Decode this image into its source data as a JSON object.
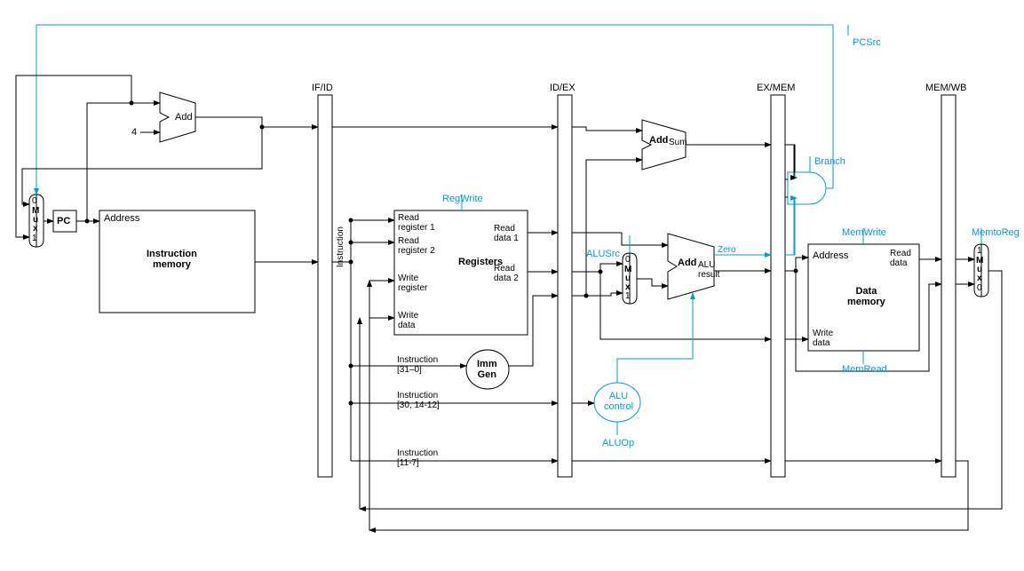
{
  "pcsrc": "PCSrc",
  "add1": "Add",
  "const4": "4",
  "ifid": "IF/ID",
  "idex": "ID/EX",
  "exmem": "EX/MEM",
  "memwb": "MEM/WB",
  "addsum_add": "Add",
  "addsum_sum": "Sum",
  "branch": "Branch",
  "pc": "PC",
  "address1": "Address",
  "imem": "Instruction\nmemory",
  "instruction_v": "Instruction",
  "regwrite": "RegWrite",
  "rr1": "Read\nregister 1",
  "rr2": "Read\nregister 2",
  "wr": "Write\nregister",
  "wd": "Write\ndata",
  "rd1": "Read\ndata 1",
  "rd2": "Read\ndata 2",
  "registers": "Registers",
  "alusrc": "ALUSrc",
  "zero": "Zero",
  "alu_add": "Add",
  "alu_res": "ALU\nresult",
  "memwrite": "MemWrite",
  "memtoreg": "MemtoReg",
  "address2": "Address",
  "rdata": "Read\ndata",
  "dmem": "Data\nmemory",
  "wd2": "Write\ndata",
  "memread": "MemRead",
  "inst31_0": "Instruction\n[31–0]",
  "immgen": "Imm\nGen",
  "inst30": "Instruction\n[30, 14-12]",
  "aluctrl": "ALU\ncontrol",
  "inst11_7": "Instruction\n[11-7]",
  "aluop": "ALUOp",
  "mux0": "0",
  "mux1": "1",
  "mux_m": "M",
  "mux_u": "u",
  "mux_x": "x"
}
